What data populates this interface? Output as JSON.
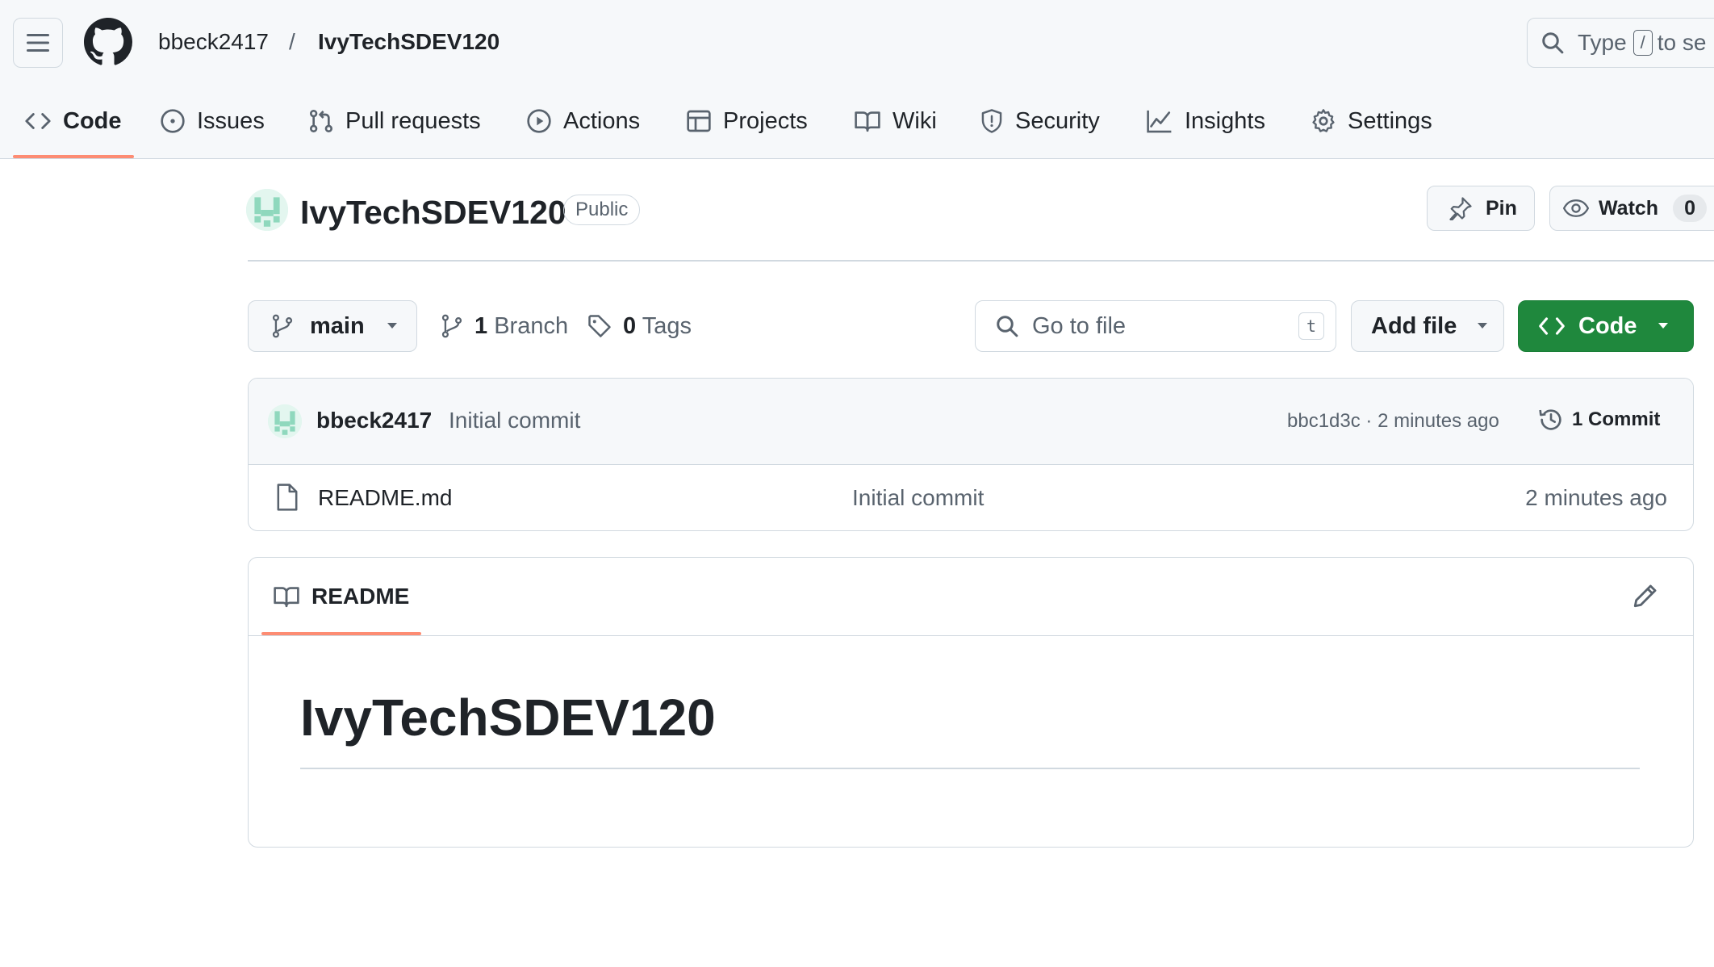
{
  "header": {
    "owner": "bbeck2417",
    "separator": "/",
    "repo": "IvyTechSDEV120",
    "search": {
      "prefix": "Type",
      "key": "/",
      "suffix": "to se"
    }
  },
  "nav": {
    "tabs": [
      {
        "label": "Code",
        "icon": "code-icon",
        "selected": true
      },
      {
        "label": "Issues",
        "icon": "issue-opened-icon"
      },
      {
        "label": "Pull requests",
        "icon": "git-pull-request-icon"
      },
      {
        "label": "Actions",
        "icon": "play-icon"
      },
      {
        "label": "Projects",
        "icon": "table-icon"
      },
      {
        "label": "Wiki",
        "icon": "book-icon"
      },
      {
        "label": "Security",
        "icon": "shield-icon"
      },
      {
        "label": "Insights",
        "icon": "graph-icon"
      },
      {
        "label": "Settings",
        "icon": "gear-icon"
      }
    ],
    "underline_color": "#fd8c73"
  },
  "repo": {
    "title": "IvyTechSDEV120",
    "visibility": "Public",
    "pin_label": "Pin",
    "watch_label": "Watch",
    "watch_count": "0"
  },
  "branch_bar": {
    "branch": "main",
    "branch_count": "1",
    "branch_label": "Branch",
    "tag_count": "0",
    "tag_label": "Tags",
    "go_to_file_placeholder": "Go to file",
    "go_to_file_key": "t",
    "add_file_label": "Add file",
    "code_label": "Code",
    "code_button_color": "#1f883d"
  },
  "latest_commit": {
    "author": "bbeck2417",
    "message": "Initial commit",
    "sha_time": "bbc1d3c · 2 minutes ago",
    "commit_count_label": "1 Commit"
  },
  "files": [
    {
      "name": "README.md",
      "message": "Initial commit",
      "time": "2 minutes ago",
      "icon": "file-icon"
    }
  ],
  "readme": {
    "tab_label": "README",
    "heading": "IvyTechSDEV120"
  }
}
